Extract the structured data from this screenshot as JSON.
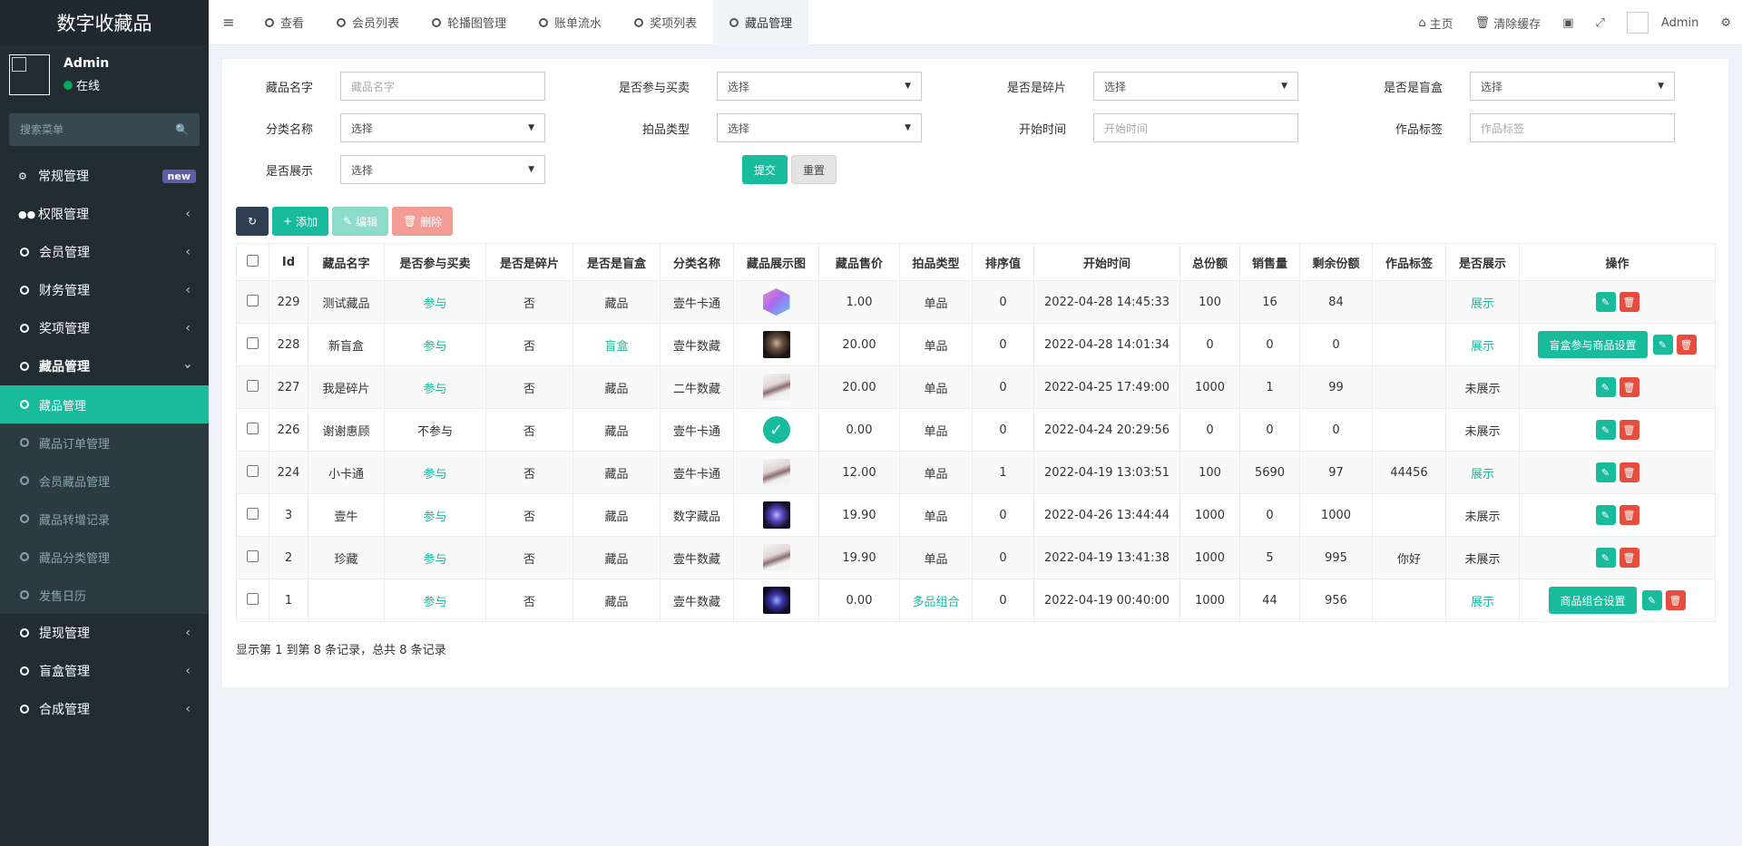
{
  "app": {
    "title": "数字收藏品"
  },
  "user": {
    "name": "Admin",
    "status": "在线"
  },
  "sidebar": {
    "search_placeholder": "搜索菜单",
    "items": [
      {
        "label": "常规管理",
        "badge": "new"
      },
      {
        "label": "权限管理"
      },
      {
        "label": "会员管理"
      },
      {
        "label": "财务管理"
      },
      {
        "label": "奖项管理"
      },
      {
        "label": "藏品管理"
      },
      {
        "label": "提现管理"
      },
      {
        "label": "盲盒管理"
      },
      {
        "label": "合成管理"
      }
    ],
    "sub_items": [
      {
        "label": "藏品管理",
        "active": true
      },
      {
        "label": "藏品订单管理"
      },
      {
        "label": "会员藏品管理"
      },
      {
        "label": "藏品转增记录"
      },
      {
        "label": "藏品分类管理"
      },
      {
        "label": "发售日历"
      }
    ]
  },
  "header": {
    "tabs": [
      {
        "label": "查看"
      },
      {
        "label": "会员列表"
      },
      {
        "label": "轮播图管理"
      },
      {
        "label": "账单流水"
      },
      {
        "label": "奖项列表"
      },
      {
        "label": "藏品管理",
        "active": true
      }
    ],
    "right": {
      "home": "主页",
      "clear_cache": "清除缓存",
      "admin": "Admin"
    }
  },
  "filters": {
    "name": {
      "label": "藏品名字",
      "placeholder": "藏品名字"
    },
    "participate": {
      "label": "是否参与买卖",
      "value": "选择"
    },
    "fragment": {
      "label": "是否是碎片",
      "value": "选择"
    },
    "blindbox": {
      "label": "是否是盲盒",
      "value": "选择"
    },
    "category": {
      "label": "分类名称",
      "value": "选择"
    },
    "auction_type": {
      "label": "拍品类型",
      "value": "选择"
    },
    "start_time": {
      "label": "开始时间",
      "placeholder": "开始时间"
    },
    "tag": {
      "label": "作品标签",
      "placeholder": "作品标签"
    },
    "display": {
      "label": "是否展示",
      "value": "选择"
    },
    "submit": "提交",
    "reset": "重置"
  },
  "toolbar": {
    "add": "添加",
    "edit": "编辑",
    "delete": "删除"
  },
  "table": {
    "headers": [
      "Id",
      "藏品名字",
      "是否参与买卖",
      "是否是碎片",
      "是否是盲盒",
      "分类名称",
      "藏品展示图",
      "藏品售价",
      "拍品类型",
      "排序值",
      "开始时间",
      "总份额",
      "销售量",
      "剩余份额",
      "作品标签",
      "是否展示",
      "操作"
    ],
    "rows": [
      {
        "id": "229",
        "name": "测试藏品",
        "participate": "参与",
        "fragment": "否",
        "blindbox": "藏品",
        "category": "壹牛卡通",
        "thumb": "cube",
        "price": "1.00",
        "type": "单品",
        "sort": "0",
        "start": "2022-04-28 14:45:33",
        "total": "100",
        "sold": "16",
        "remain": "84",
        "tag": "",
        "display": "展示",
        "extra_btn": ""
      },
      {
        "id": "228",
        "name": "新盲盒",
        "participate": "参与",
        "fragment": "否",
        "blindbox": "盲盒",
        "category": "壹牛数藏",
        "thumb": "dark1",
        "price": "20.00",
        "type": "单品",
        "sort": "0",
        "start": "2022-04-28 14:01:34",
        "total": "0",
        "sold": "0",
        "remain": "0",
        "tag": "",
        "display": "展示",
        "extra_btn": "盲盒参与商品设置"
      },
      {
        "id": "227",
        "name": "我是碎片",
        "participate": "参与",
        "fragment": "否",
        "blindbox": "藏品",
        "category": "二牛数藏",
        "thumb": "light",
        "price": "20.00",
        "type": "单品",
        "sort": "0",
        "start": "2022-04-25 17:49:00",
        "total": "1000",
        "sold": "1",
        "remain": "99",
        "tag": "",
        "display": "未展示",
        "extra_btn": ""
      },
      {
        "id": "226",
        "name": "谢谢惠顾",
        "participate": "不参与",
        "fragment": "否",
        "blindbox": "藏品",
        "category": "壹牛卡通",
        "thumb": "check",
        "price": "0.00",
        "type": "单品",
        "sort": "0",
        "start": "2022-04-24 20:29:56",
        "total": "0",
        "sold": "0",
        "remain": "0",
        "tag": "",
        "display": "未展示",
        "extra_btn": ""
      },
      {
        "id": "224",
        "name": "小卡通",
        "participate": "参与",
        "fragment": "否",
        "blindbox": "藏品",
        "category": "壹牛卡通",
        "thumb": "light",
        "price": "12.00",
        "type": "单品",
        "sort": "1",
        "start": "2022-04-19 13:03:51",
        "total": "100",
        "sold": "5690",
        "remain": "97",
        "tag": "44456",
        "display": "展示",
        "extra_btn": ""
      },
      {
        "id": "3",
        "name": "壹牛",
        "participate": "参与",
        "fragment": "否",
        "blindbox": "藏品",
        "category": "数字藏品",
        "thumb": "dark2",
        "price": "19.90",
        "type": "单品",
        "sort": "0",
        "start": "2022-04-26 13:44:44",
        "total": "1000",
        "sold": "0",
        "remain": "1000",
        "tag": "",
        "display": "未展示",
        "extra_btn": ""
      },
      {
        "id": "2",
        "name": "珍藏",
        "participate": "参与",
        "fragment": "否",
        "blindbox": "藏品",
        "category": "壹牛数藏",
        "thumb": "light",
        "price": "19.90",
        "type": "单品",
        "sort": "0",
        "start": "2022-04-19 13:41:38",
        "total": "1000",
        "sold": "5",
        "remain": "995",
        "tag": "你好",
        "display": "未展示",
        "extra_btn": ""
      },
      {
        "id": "1",
        "name": "",
        "participate": "参与",
        "fragment": "否",
        "blindbox": "藏品",
        "category": "壹牛数藏",
        "thumb": "dark3",
        "price": "0.00",
        "type": "多品组合",
        "sort": "0",
        "start": "2022-04-19 00:40:00",
        "total": "1000",
        "sold": "44",
        "remain": "956",
        "tag": "",
        "display": "展示",
        "extra_btn": "商品组合设置"
      }
    ]
  },
  "pager": {
    "info": "显示第 1 到第 8 条记录，总共 8 条记录"
  }
}
